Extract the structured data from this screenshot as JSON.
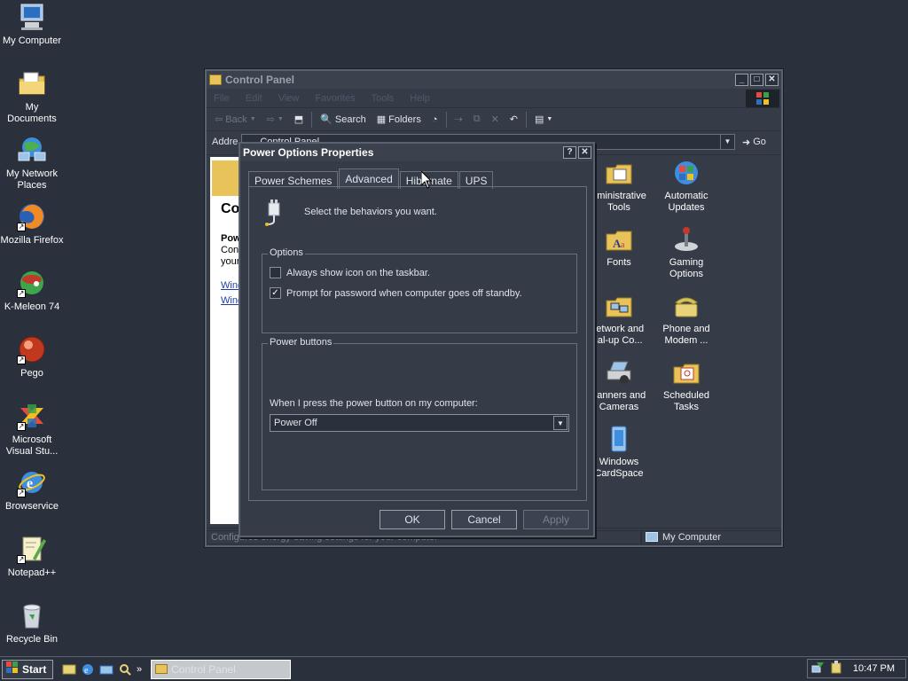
{
  "desktop": {
    "icons": [
      {
        "label": "My Computer"
      },
      {
        "label": "My Documents"
      },
      {
        "label": "My Network Places"
      },
      {
        "label": "Mozilla Firefox"
      },
      {
        "label": "K-Meleon 74"
      },
      {
        "label": "Pego"
      },
      {
        "label": "Microsoft Visual Stu..."
      },
      {
        "label": "Browservice"
      },
      {
        "label": "Notepad++"
      },
      {
        "label": "Recycle Bin"
      }
    ]
  },
  "control_panel": {
    "title": "Control Panel",
    "menu": [
      "File",
      "Edit",
      "View",
      "Favorites",
      "Tools",
      "Help"
    ],
    "toolbar": {
      "back": "Back",
      "search": "Search",
      "folders": "Folders"
    },
    "address_label": "Addre",
    "address_value": "Control Panel",
    "go": "Go",
    "left_pane": {
      "heading": "Co",
      "line1": "Pow",
      "line2": "Conf",
      "line3": "your",
      "link1": "Wind",
      "link2": "Wind"
    },
    "items": [
      {
        "label": "dministrative Tools",
        "icon": "admin-tools-icon"
      },
      {
        "label": "Automatic Updates",
        "icon": "automatic-updates-icon"
      },
      {
        "label": "Fonts",
        "icon": "fonts-icon"
      },
      {
        "label": "Gaming Options",
        "icon": "gaming-options-icon"
      },
      {
        "label": "letwork and ial-up Co...",
        "icon": "network-connections-icon"
      },
      {
        "label": "Phone and Modem ...",
        "icon": "phone-modem-icon"
      },
      {
        "label": "canners and Cameras",
        "icon": "scanners-cameras-icon"
      },
      {
        "label": "Scheduled Tasks",
        "icon": "scheduled-tasks-icon"
      },
      {
        "label": "Windows CardSpace",
        "icon": "windows-cardspace-icon"
      }
    ],
    "status_text": "Configures energy-saving settings for your computer",
    "status_location": "My Computer"
  },
  "dialog": {
    "title": "Power Options Properties",
    "help_btn": "?",
    "close_btn": "✕",
    "tabs": [
      "Power Schemes",
      "Advanced",
      "Hibernate",
      "UPS"
    ],
    "active_tab": "Advanced",
    "intro": "Select the behaviors you want.",
    "options_legend": "Options",
    "option1": {
      "label": "Always show icon on the taskbar.",
      "checked": false
    },
    "option2": {
      "label": "Prompt for password when computer goes off standby.",
      "checked": true
    },
    "power_buttons_legend": "Power buttons",
    "power_button_prompt": "When I press the power button on my computer:",
    "power_button_value": "Power Off",
    "ok": "OK",
    "cancel": "Cancel",
    "apply": "Apply"
  },
  "taskbar": {
    "start": "Start",
    "task": "Control Panel",
    "clock": "10:47 PM"
  },
  "colors": {
    "desktop": "#2b313c",
    "window": "#363c47",
    "border": "#6a717d"
  }
}
